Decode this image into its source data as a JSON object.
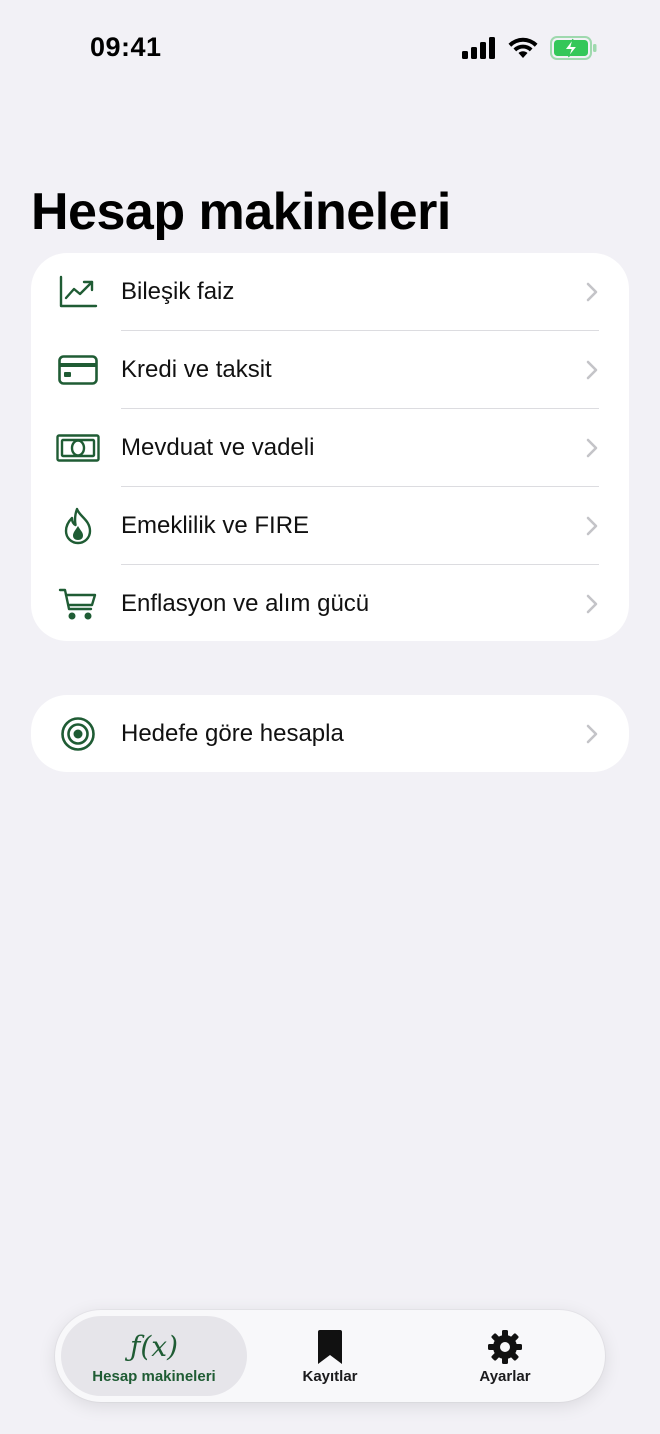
{
  "status_bar": {
    "time": "09:41"
  },
  "page": {
    "title": "Hesap makineleri"
  },
  "calculators": [
    {
      "label": "Bileşik faiz",
      "icon": "chart-trend-icon"
    },
    {
      "label": "Kredi ve taksit",
      "icon": "credit-card-icon"
    },
    {
      "label": "Mevduat ve vadeli",
      "icon": "banknote-icon"
    },
    {
      "label": "Emeklilik ve FIRE",
      "icon": "flame-icon"
    },
    {
      "label": "Enflasyon ve alım gücü",
      "icon": "cart-icon"
    }
  ],
  "goal": {
    "label": "Hedefe göre hesapla",
    "icon": "target-icon"
  },
  "tabs": [
    {
      "label": "Hesap makineleri",
      "icon": "function-icon",
      "glyph": "ƒ(x)",
      "active": true
    },
    {
      "label": "Kayıtlar",
      "icon": "bookmark-icon",
      "active": false
    },
    {
      "label": "Ayarlar",
      "icon": "gear-icon",
      "active": false
    }
  ],
  "colors": {
    "accent": "#1f5c34",
    "background": "#f2f1f6",
    "card": "#ffffff",
    "battery": "#34c759"
  }
}
